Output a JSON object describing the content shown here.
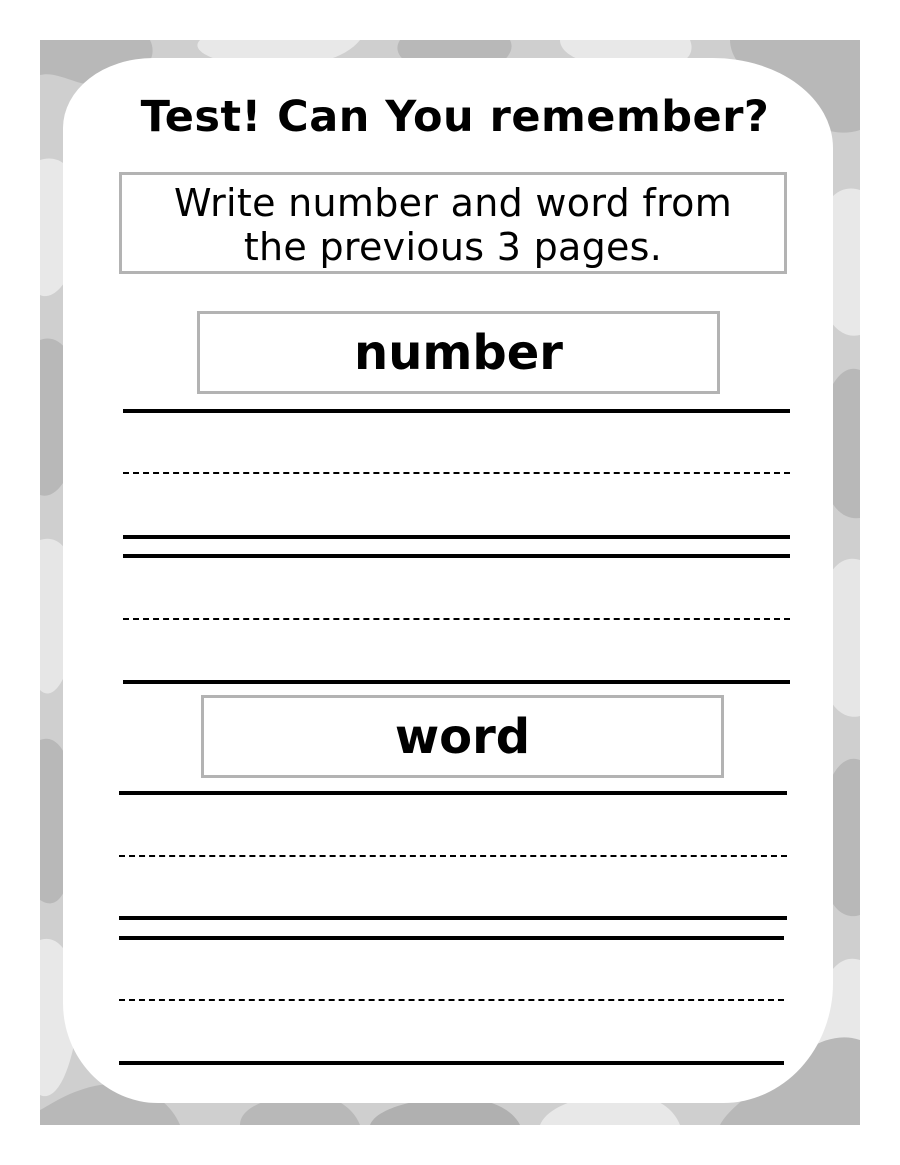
{
  "worksheet": {
    "title": "Test! Can You remember?",
    "instructions_line1": "Write number and word from",
    "instructions_line2": "the previous 3 pages.",
    "sections": [
      {
        "label": "number"
      },
      {
        "label": "word"
      }
    ]
  },
  "colors": {
    "frame_base": "#cfcfcf",
    "frame_dark": "#b8b8b8",
    "frame_light": "#e6e6e6",
    "box_border": "#b3b3b3",
    "ink": "#000000"
  }
}
